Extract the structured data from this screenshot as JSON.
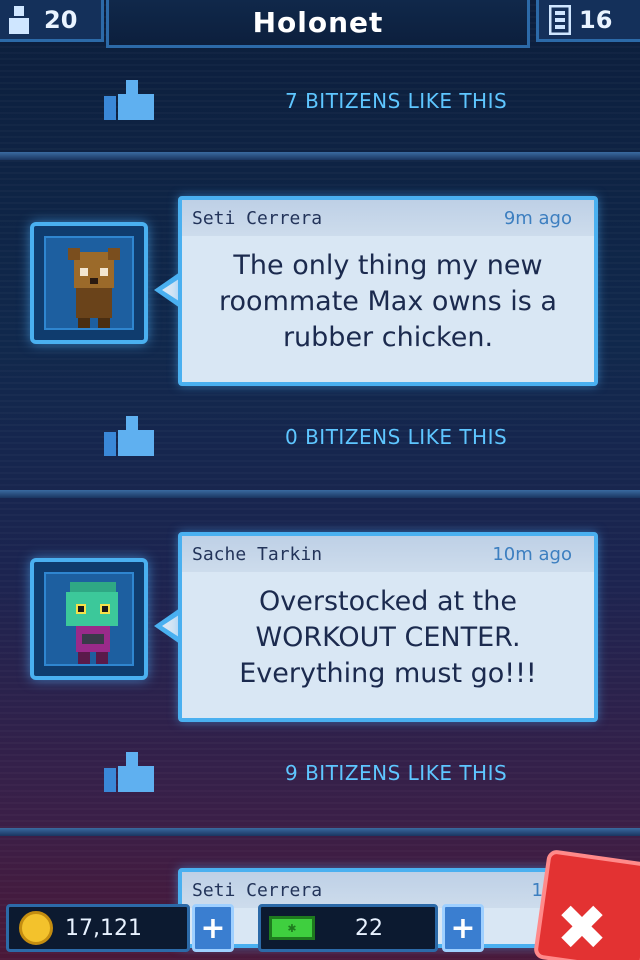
{
  "header": {
    "population": "20",
    "title": "Holonet",
    "floors": "16"
  },
  "feed": [
    {
      "likes_text": "7 BITIZENS LIKE THIS"
    },
    {
      "author": "Seti Cerrera",
      "time": "9m ago",
      "message": "The only thing my new roommate Max owns is a rubber chicken.",
      "likes_text": "0 BITIZENS LIKE THIS"
    },
    {
      "author": "Sache Tarkin",
      "time": "10m ago",
      "message": "Overstocked at the WORKOUT CENTER. Everything must go!!!",
      "likes_text": "9 BITIZENS LIKE THIS"
    },
    {
      "author": "Seti Cerrera",
      "time": "11m"
    }
  ],
  "footer": {
    "coins": "17,121",
    "bux": "22",
    "plus_label": "+",
    "close_label": "✖"
  }
}
